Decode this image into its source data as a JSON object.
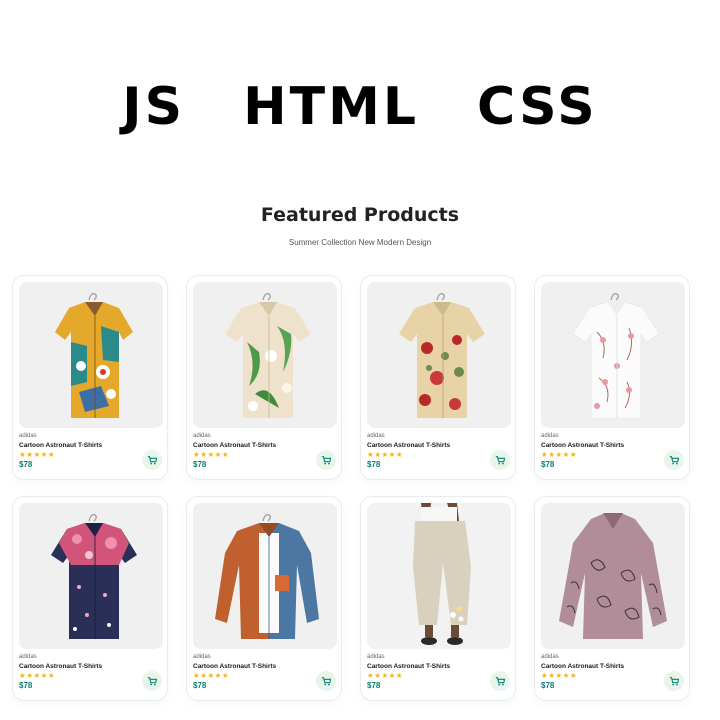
{
  "hero": {
    "words": [
      "JS",
      "HTML",
      "CSS"
    ]
  },
  "section": {
    "title": "Featured Products",
    "subtitle": "Summer Collection New Modern Design"
  },
  "colors": {
    "accent": "#088178",
    "star": "#f3b519",
    "cart_bg": "#e8f6ea"
  },
  "products": [
    {
      "brand": "adidas",
      "name": "Cartoon Astronaut T-Shirts",
      "stars": "★★★★★",
      "price": "$78",
      "image": "shirt-abstract-yellow-teal"
    },
    {
      "brand": "adidas",
      "name": "Cartoon Astronaut T-Shirts",
      "stars": "★★★★★",
      "price": "$78",
      "image": "shirt-tropical-leaf"
    },
    {
      "brand": "adidas",
      "name": "Cartoon Astronaut T-Shirts",
      "stars": "★★★★★",
      "price": "$78",
      "image": "shirt-floral-beige"
    },
    {
      "brand": "adidas",
      "name": "Cartoon Astronaut T-Shirts",
      "stars": "★★★★★",
      "price": "$78",
      "image": "shirt-white-pink-blossom"
    },
    {
      "brand": "adidas",
      "name": "Cartoon Astronaut T-Shirts",
      "stars": "★★★★★",
      "price": "$78",
      "image": "shirt-navy-floral"
    },
    {
      "brand": "adidas",
      "name": "Cartoon Astronaut T-Shirts",
      "stars": "★★★★★",
      "price": "$78",
      "image": "shirt-orange-denim-colorblock"
    },
    {
      "brand": "adidas",
      "name": "Cartoon Astronaut T-Shirts",
      "stars": "★★★★★",
      "price": "$78",
      "image": "pants-beige-linen"
    },
    {
      "brand": "adidas",
      "name": "Cartoon Astronaut T-Shirts",
      "stars": "★★★★★",
      "price": "$78",
      "image": "blouse-mauve-pattern"
    }
  ]
}
